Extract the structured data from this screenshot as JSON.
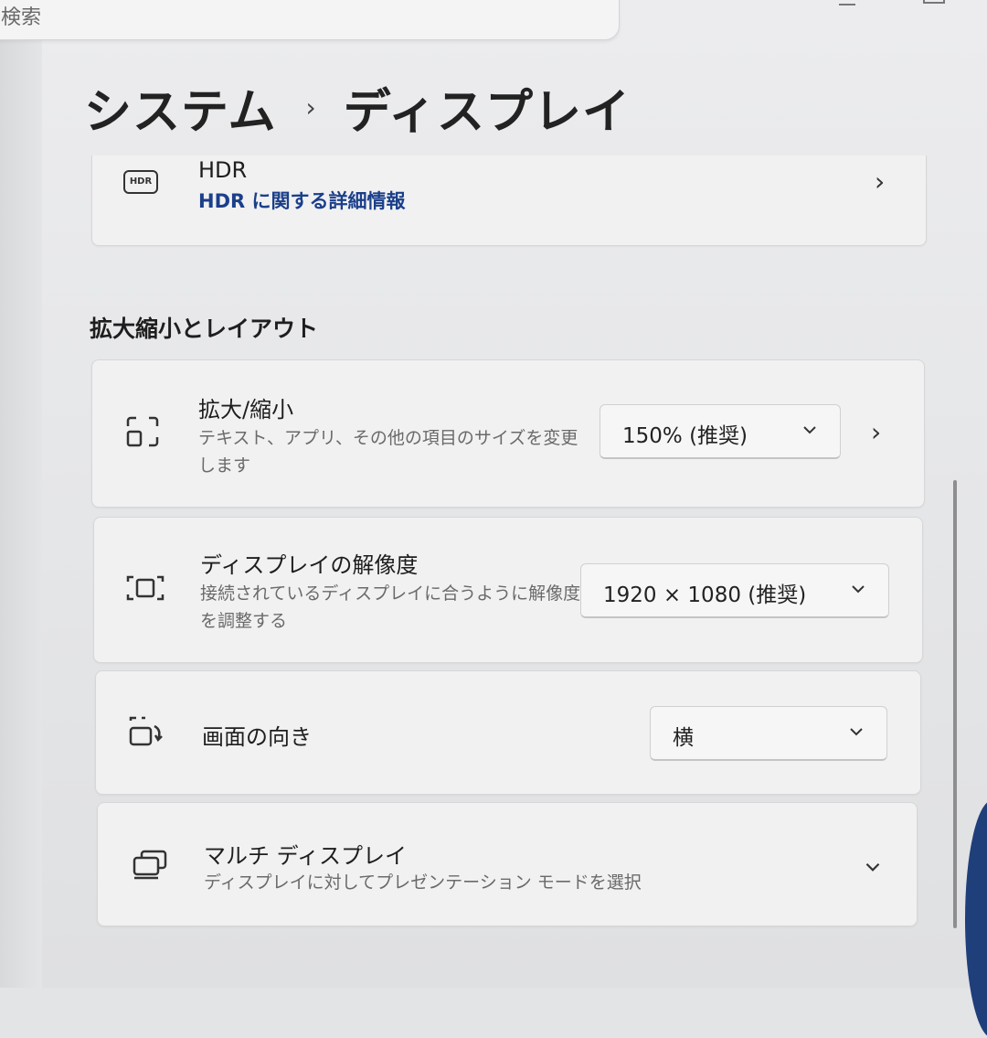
{
  "search": {
    "text": "検索"
  },
  "breadcrumb": {
    "parent": "システム",
    "current": "ディスプレイ"
  },
  "hdr": {
    "icon_text": "HDR",
    "title": "HDR",
    "link": "HDR に関する詳細情報"
  },
  "section": {
    "title": "拡大縮小とレイアウト"
  },
  "scale": {
    "title": "拡大/縮小",
    "desc": "テキスト、アプリ、その他の項目のサイズを変更します",
    "value": "150% (推奨)"
  },
  "resolution": {
    "title": "ディスプレイの解像度",
    "desc": "接続されているディスプレイに合うように解像度を調整する",
    "value": "1920 × 1080 (推奨)"
  },
  "orientation": {
    "title": "画面の向き",
    "value": "横"
  },
  "multi_display": {
    "title": "マルチ ディスプレイ",
    "desc": "ディスプレイに対してプレゼンテーション モードを選択"
  },
  "icons": {
    "hdr": "hdr-icon",
    "scale": "scale-icon",
    "resolution": "resolution-icon",
    "orientation": "orientation-icon",
    "multi_display": "multi-display-icon",
    "chevron_right": "chevron-right-icon",
    "chevron_down": "chevron-down-icon"
  },
  "colors": {
    "link": "#1b3f8a",
    "card_bg": "#f1f1f2",
    "page_bg": "#e6e7e9"
  }
}
